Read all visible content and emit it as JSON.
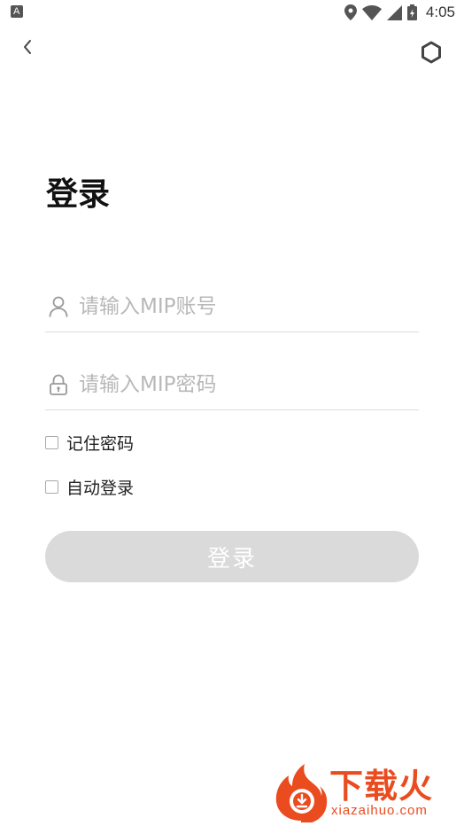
{
  "status_bar": {
    "time": "4:05",
    "icons": [
      "location-icon",
      "wifi-icon",
      "cell-signal-icon",
      "battery-icon"
    ]
  },
  "nav": {
    "back_icon": "chevron-left-icon",
    "settings_icon": "hexagon-settings-icon"
  },
  "title": "登录",
  "form": {
    "account": {
      "icon": "user-icon",
      "value": "",
      "placeholder": "请输入MIP账号"
    },
    "password": {
      "icon": "lock-icon",
      "value": "",
      "placeholder": "请输入MIP密码"
    },
    "remember_password": {
      "label": "记住密码",
      "checked": false
    },
    "auto_login": {
      "label": "自动登录",
      "checked": false
    },
    "submit_label": "登录"
  },
  "watermark": {
    "title": "下载火",
    "domain": "xiazaihuo.com"
  },
  "colors": {
    "button_disabled_bg": "#dadada",
    "placeholder": "#b8b8b8",
    "divider": "#dddddd",
    "watermark_accent": "#ea4b1f"
  }
}
